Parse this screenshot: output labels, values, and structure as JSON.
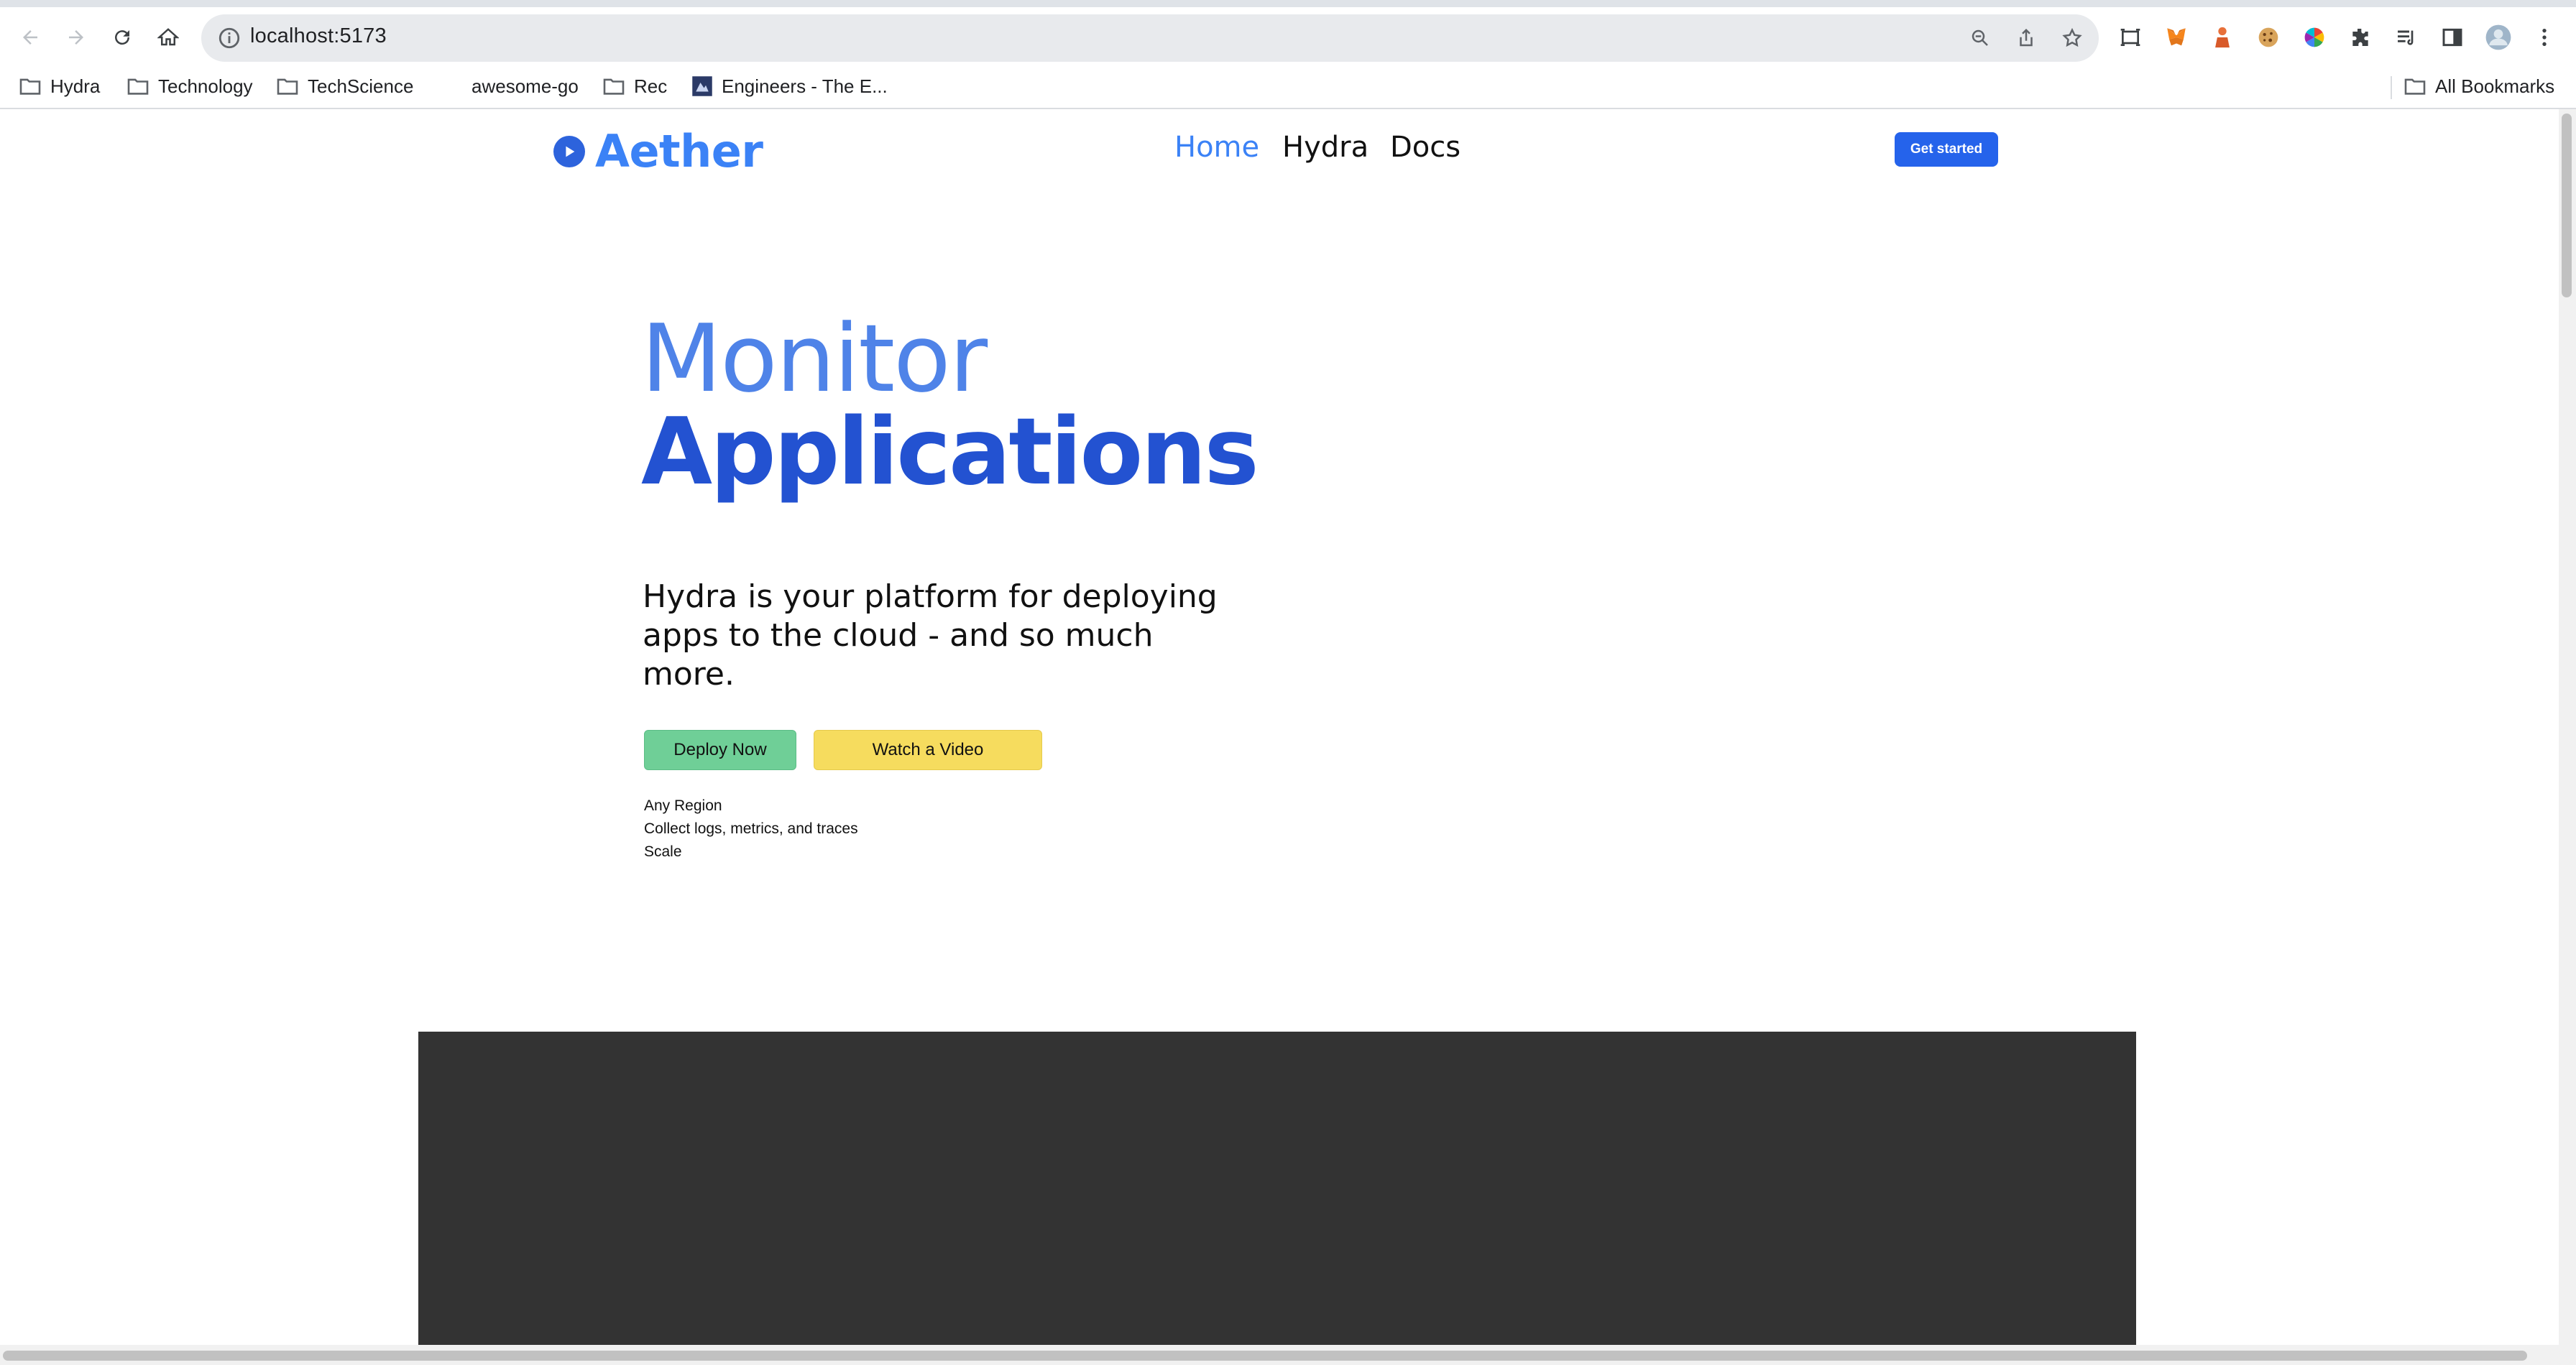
{
  "browser": {
    "url": "localhost:5173",
    "bookmarks": [
      {
        "label": "Hydra",
        "icon": "folder-icon"
      },
      {
        "label": "Technology",
        "icon": "folder-icon"
      },
      {
        "label": "TechScience",
        "icon": "folder-icon"
      },
      {
        "label": "awesome-go",
        "icon": "none"
      },
      {
        "label": "Rec",
        "icon": "folder-icon"
      },
      {
        "label": "Engineers - The E...",
        "icon": "site-favicon-icon"
      }
    ],
    "all_bookmarks": "All Bookmarks"
  },
  "site": {
    "brand": "Aether",
    "nav": [
      "Home",
      "Hydra",
      "Docs"
    ],
    "cta": "Get started",
    "hero_line1": "Monitor",
    "hero_line2": "Applications",
    "subtitle": "Hydra is your platform for deploying apps to the cloud - and so much more.",
    "buttons": {
      "deploy": "Deploy Now",
      "video": "Watch a Video"
    },
    "features": [
      "Any Region",
      "Collect logs, metrics, and traces",
      "Scale"
    ]
  },
  "colors": {
    "brand_blue": "#3b82f6",
    "heading_dark_blue": "#2352d1",
    "cta_blue": "#2563eb",
    "deploy_green": "#6fcf97",
    "video_yellow": "#f6dc5e",
    "dark_section": "#333333"
  }
}
